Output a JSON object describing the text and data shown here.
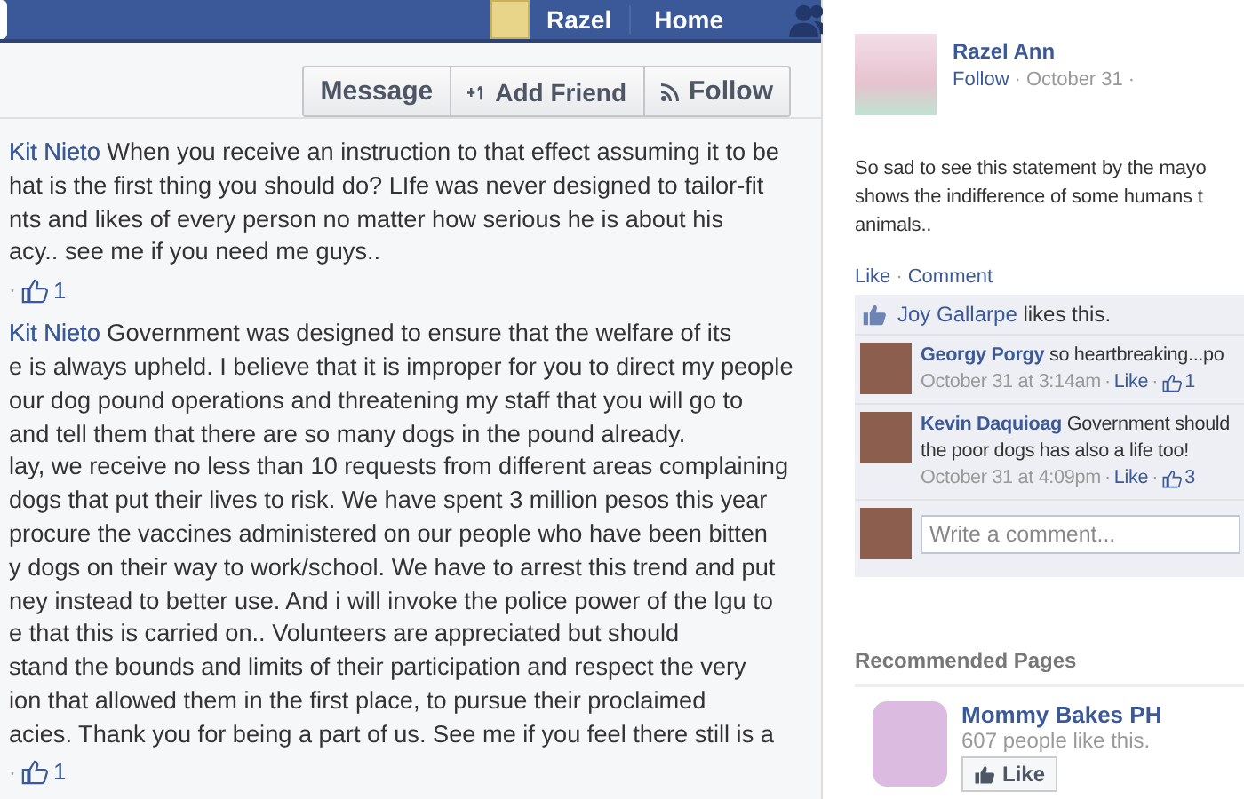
{
  "top_bar": {
    "user_name": "Razel",
    "nav_items": [
      "Home"
    ]
  },
  "profile_actions": [
    {
      "label": "Message",
      "kind": "plain"
    },
    {
      "label": "Add Friend",
      "kind": "add"
    },
    {
      "label": "Follow",
      "kind": "follow"
    }
  ],
  "replies": [
    {
      "name": "Kit Nieto",
      "first_line": "When you receive an instruction to that effect assuming it to be",
      "lines": [
        "hat is the first thing you should do? LIfe was never designed to tailor-fit",
        "nts and likes of every person no matter how serious he is about his",
        "acy.. see me if you need me guys.."
      ],
      "separator": "·",
      "likes": "1"
    },
    {
      "name": "Kit Nieto",
      "first_line": "Government was designed to ensure that the welfare of its",
      "lines": [
        "e is always upheld. I believe that it is improper for you to direct my people",
        "our dog pound operations and threatening my staff that you will go to",
        "and tell them that there are so many dogs in the pound already.",
        "lay, we receive no less than 10 requests from different areas complaining",
        "dogs that put their lives to risk. We have spent 3 million pesos this year",
        "procure the vaccines administered on our people who have been bitten",
        "y dogs on their way to work/school. We have to arrest this trend and put",
        "ney instead to better use. And i will invoke the police power of the lgu to",
        "e that this is carried on.. Volunteers are appreciated but should",
        "stand the bounds and limits of their participation and respect the very",
        "ion that allowed them in the first place, to pursue their proclaimed",
        "acies. Thank you for being a part of us. See me if you feel there still is a"
      ],
      "separator": "·",
      "likes": "1"
    }
  ],
  "post": {
    "author": "Razel Ann",
    "follow": "Follow",
    "separator": "·",
    "date": "October 31",
    "lines": [
      "So sad to see this statement by the mayo",
      "shows the indifference of some humans t",
      "animals.."
    ],
    "actions": [
      "Like",
      "Comment"
    ],
    "liked_by": {
      "name": "Joy Gallarpe",
      "text": "likes this."
    },
    "comments": [
      {
        "name": "Georgy Porgy",
        "lines": [
          "so heartbreaking...po"
        ],
        "time": "October 31 at 3:14am",
        "like": "Like",
        "likes": "1"
      },
      {
        "name": "Kevin Daquioag",
        "lines": [
          "Government should",
          "the poor dogs has also a life too!"
        ],
        "time": "October 31 at 4:09pm",
        "like": "Like",
        "likes": "3"
      }
    ],
    "comment_placeholder": "Write a comment..."
  },
  "recommended": {
    "title": "Recommended Pages",
    "pages": [
      {
        "name": "Mommy Bakes PH",
        "likes_text": "607 people like this.",
        "button": "Like"
      }
    ]
  }
}
